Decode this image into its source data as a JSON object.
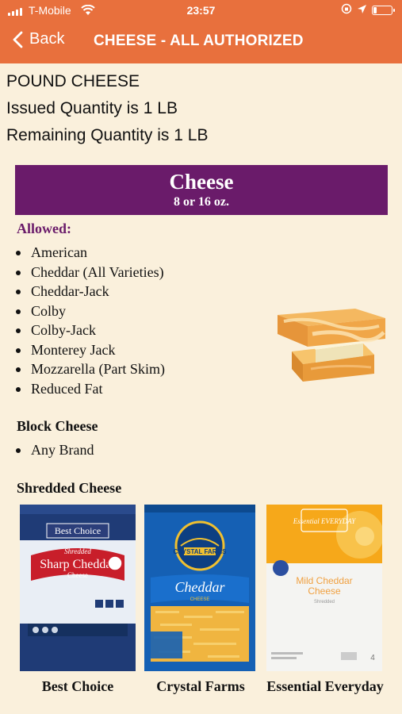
{
  "status_bar": {
    "carrier": "T-Mobile",
    "time": "23:57"
  },
  "nav": {
    "back_label": "Back",
    "title": "CHEESE - ALL AUTHORIZED"
  },
  "info": {
    "line1": "POUND CHEESE",
    "line2": "Issued Quantity is 1 LB",
    "line3": "Remaining Quantity is 1 LB"
  },
  "banner": {
    "title": "Cheese",
    "subtitle": "8 or 16 oz."
  },
  "allowed": {
    "heading": "Allowed:",
    "items": [
      "American",
      "Cheddar (All Varieties)",
      "Cheddar-Jack",
      "Colby",
      "Colby-Jack",
      "Monterey Jack",
      "Mozzarella (Part Skim)",
      "Reduced Fat"
    ]
  },
  "block_cheese": {
    "heading": "Block Cheese",
    "items": [
      "Any Brand"
    ]
  },
  "shredded_cheese": {
    "heading": "Shredded Cheese",
    "products": [
      {
        "label": "Best Choice",
        "pack_brand": "Best Choice",
        "pack_text1": "Shredded",
        "pack_text2": "Sharp Cheddar",
        "pack_text3": "Cheese"
      },
      {
        "label": "Crystal Farms",
        "pack_brand": "CRYSTAL FARMS",
        "pack_text1": "Cheddar",
        "pack_text2": "CHEESE"
      },
      {
        "label": "Essential Everyday",
        "pack_brand": "Essential EVERYDAY",
        "pack_text1": "Mild Cheddar",
        "pack_text2": "Cheese",
        "pack_text3": "Shredded"
      }
    ]
  },
  "colors": {
    "header": "#e8703d",
    "banner": "#6a1b6a",
    "background": "#faf0dc"
  }
}
